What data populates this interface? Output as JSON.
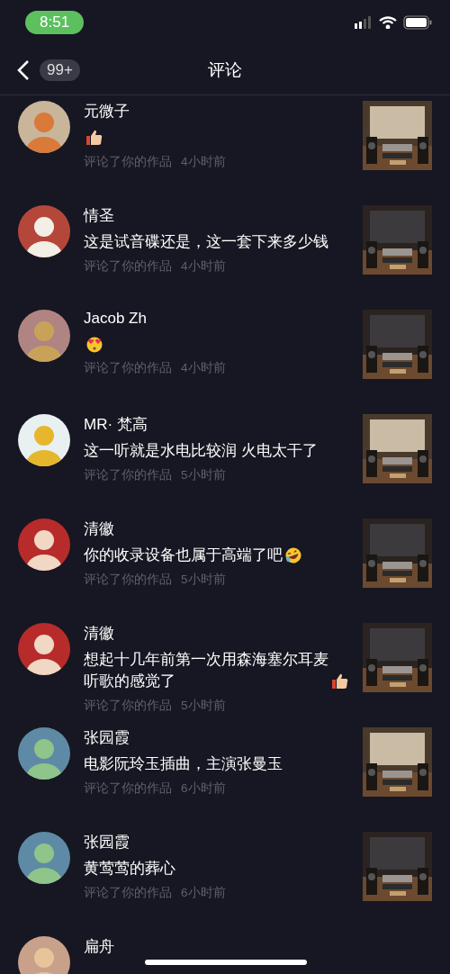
{
  "status_bar": {
    "time": "8:51"
  },
  "nav": {
    "badge": "99+",
    "title": "评论"
  },
  "comments": [
    {
      "name": "元微子",
      "kind": "thumbs-up",
      "meta": "评论了你的作品",
      "time": "4小时前"
    },
    {
      "name": "情圣",
      "text": "这是试音碟还是，这一套下来多少钱",
      "meta": "评论了你的作品",
      "time": "4小时前"
    },
    {
      "name": "Jacob Zh",
      "kind": "heart-eyes",
      "meta": "评论了你的作品",
      "time": "4小时前"
    },
    {
      "name": "MR· 梵高",
      "text": "这一听就是水电比较润 火电太干了",
      "meta": "评论了你的作品",
      "time": "5小时前"
    },
    {
      "name": "清徽",
      "text": "你的收录设备也属于高端了吧",
      "kind": "laughing",
      "meta": "评论了你的作品",
      "time": "5小时前"
    },
    {
      "name": "清徽",
      "text": "想起十几年前第一次用森海塞尔耳麦听歌的感觉了",
      "kind": "thumbs-up",
      "meta": "评论了你的作品",
      "time": "5小时前"
    },
    {
      "name": "张园霞",
      "text": "电影阮玲玉插曲，主演张曼玉",
      "meta": "评论了你的作品",
      "time": "6小时前"
    },
    {
      "name": "张园霞",
      "text": "黄莺莺的葬心",
      "meta": "评论了你的作品",
      "time": "6小时前"
    },
    {
      "name": "扁舟"
    }
  ]
}
